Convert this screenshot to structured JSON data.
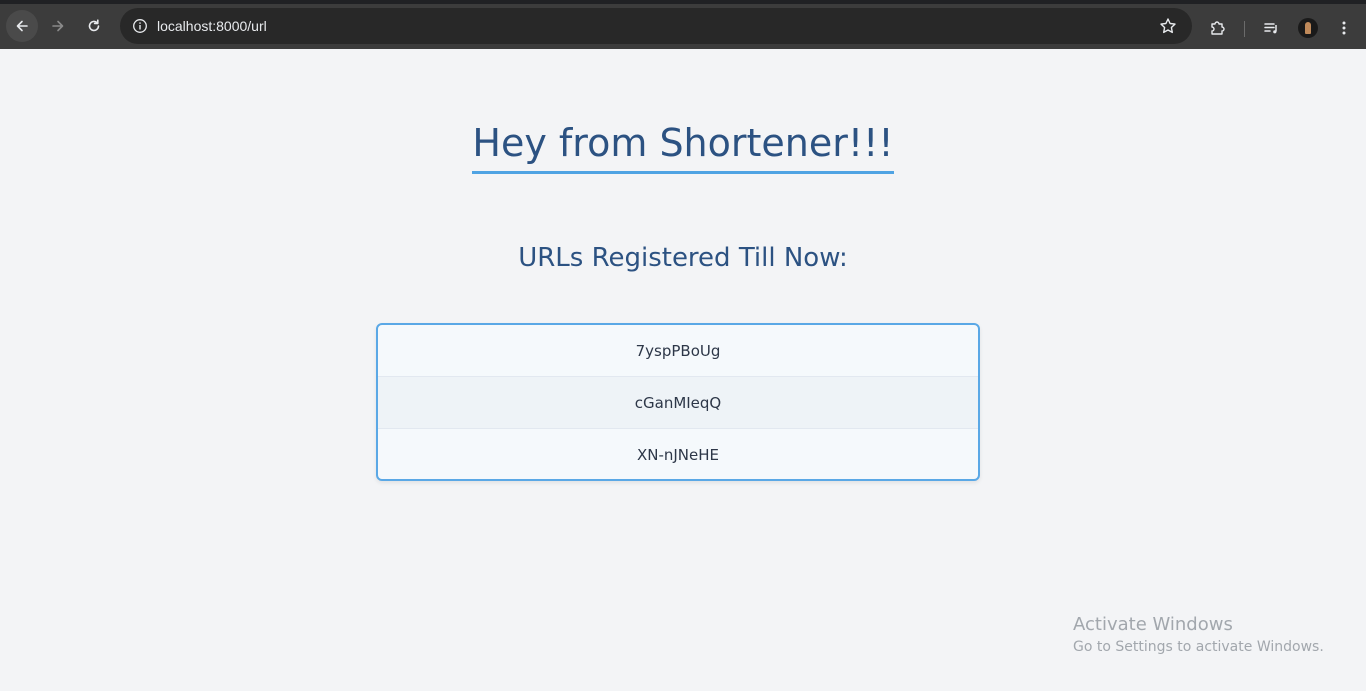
{
  "browser": {
    "url": "localhost:8000/url",
    "icons": {
      "back": "back-arrow-icon",
      "forward": "forward-arrow-icon",
      "reload": "reload-icon",
      "site_info": "info-icon",
      "bookmark": "star-icon",
      "extensions": "puzzle-icon",
      "media": "media-queue-icon",
      "profile": "avatar",
      "menu": "kebab-menu-icon"
    }
  },
  "page": {
    "title": "Hey from Shortener!!!",
    "subtitle": "URLs Registered Till Now:",
    "urls": [
      "7yspPBoUg",
      "cGanMIeqQ",
      "XN-nJNeHE"
    ]
  },
  "watermark": {
    "title": "Activate Windows",
    "subtitle": "Go to Settings to activate Windows."
  },
  "colors": {
    "heading": "#2c5282",
    "accent": "#4fa3e3",
    "background": "#f3f4f6"
  }
}
